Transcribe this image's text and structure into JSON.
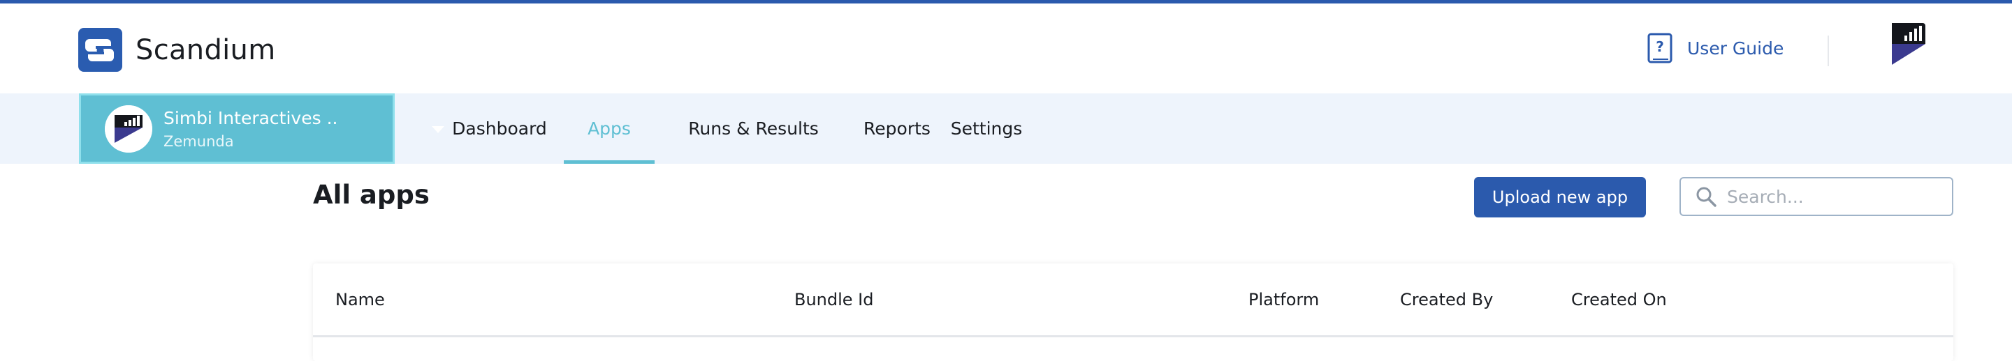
{
  "app": {
    "name": "Scandium"
  },
  "header": {
    "user_guide_label": "User Guide"
  },
  "org": {
    "name": "Simbi Interactives ...",
    "subtitle": "Zemunda"
  },
  "nav": {
    "tabs": [
      {
        "label": "Dashboard",
        "active": false
      },
      {
        "label": "Apps",
        "active": true
      },
      {
        "label": "Runs & Results",
        "active": false
      },
      {
        "label": "Reports",
        "active": false
      },
      {
        "label": "Settings",
        "active": false
      }
    ]
  },
  "main": {
    "title": "All apps",
    "upload_button": "Upload new app",
    "search": {
      "placeholder": "Search...",
      "value": ""
    },
    "table": {
      "columns": [
        "Name",
        "Bundle Id",
        "Platform",
        "Created By",
        "Created On"
      ]
    }
  },
  "colors": {
    "brand_blue": "#2b5aad",
    "accent_teal": "#5fbfd3",
    "nav_bg": "#eef4fc"
  },
  "icons": {
    "brand": "scandium-logo-icon",
    "guide": "help-book-icon",
    "user": "user-avatar-icon",
    "org": "org-avatar-icon",
    "caret": "chevron-down-icon",
    "search": "search-icon"
  }
}
